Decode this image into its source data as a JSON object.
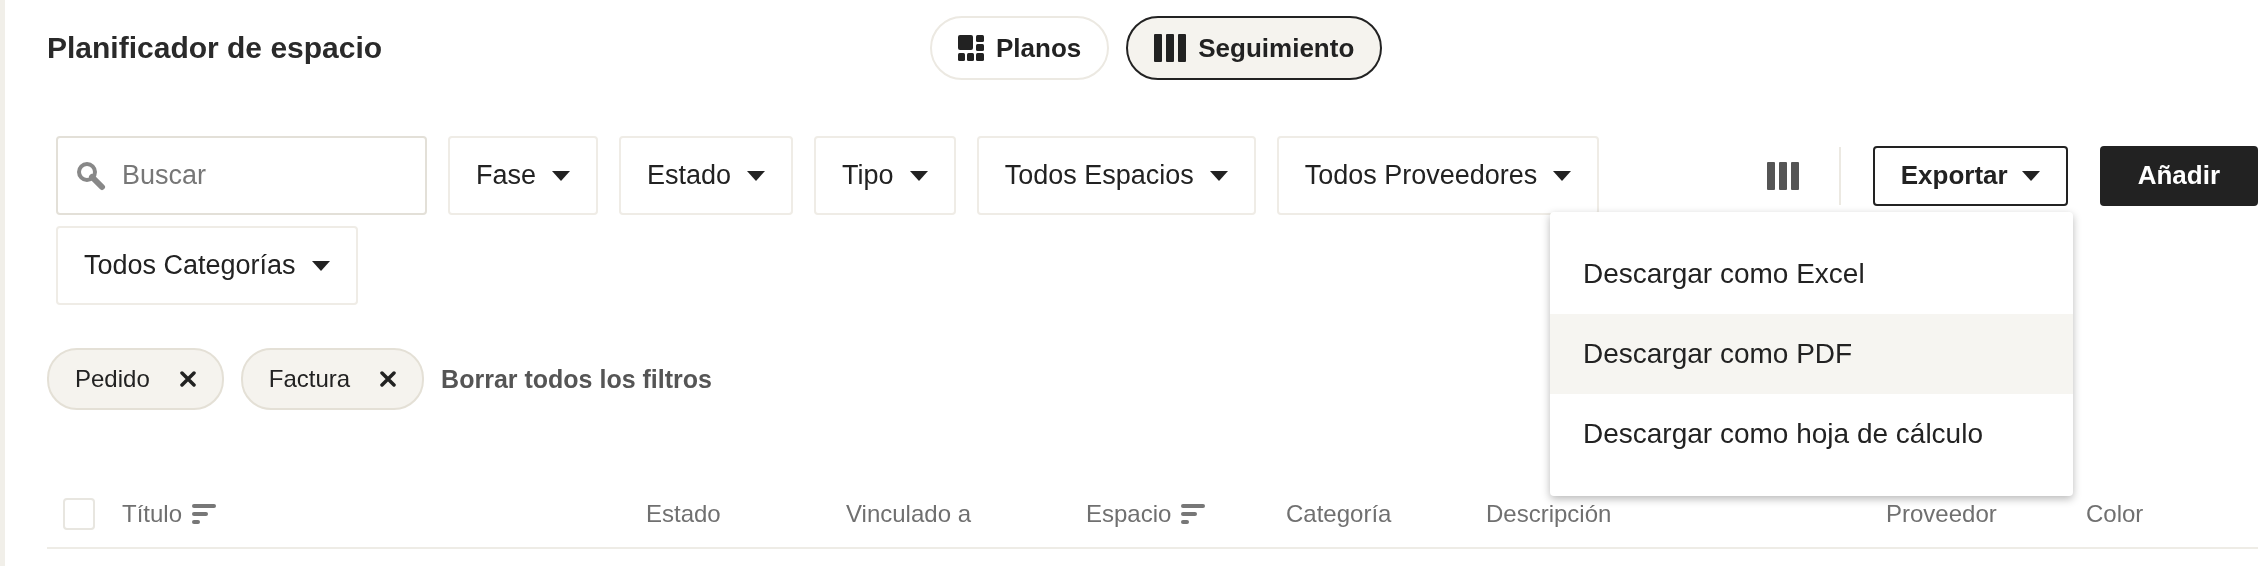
{
  "header": {
    "title": "Planificador de espacio"
  },
  "view_toggle": [
    {
      "label": "Planos",
      "kind": "grid",
      "selected": false
    },
    {
      "label": "Seguimiento",
      "kind": "columns",
      "selected": true
    }
  ],
  "search": {
    "placeholder": "Buscar"
  },
  "filters": [
    {
      "label": "Fase"
    },
    {
      "label": "Estado"
    },
    {
      "label": "Tipo"
    },
    {
      "label": "Todos Espacios"
    },
    {
      "label": "Todos Proveedores"
    },
    {
      "label": "Todos Categorías"
    }
  ],
  "export": {
    "label": "Exportar",
    "expanded": true,
    "menu": [
      {
        "label": "Descargar como Excel",
        "highlighted": false
      },
      {
        "label": "Descargar como PDF",
        "highlighted": true
      },
      {
        "label": "Descargar como hoja de cálculo",
        "highlighted": false
      }
    ]
  },
  "add_button": {
    "label": "Añadir"
  },
  "chips": [
    {
      "label": "Pedido"
    },
    {
      "label": "Factura"
    }
  ],
  "clear_filters": "Borrar todos los filtros",
  "table": {
    "select_all_checked": false,
    "columns": [
      {
        "label": "Título",
        "sortable": true
      },
      {
        "label": "Estado",
        "sortable": false
      },
      {
        "label": "Vinculado a",
        "sortable": false
      },
      {
        "label": "Espacio",
        "sortable": true
      },
      {
        "label": "Categoría",
        "sortable": false
      },
      {
        "label": "Descripción",
        "sortable": false
      },
      {
        "label": "Proveedor",
        "sortable": false
      },
      {
        "label": "Color",
        "sortable": false
      }
    ]
  }
}
